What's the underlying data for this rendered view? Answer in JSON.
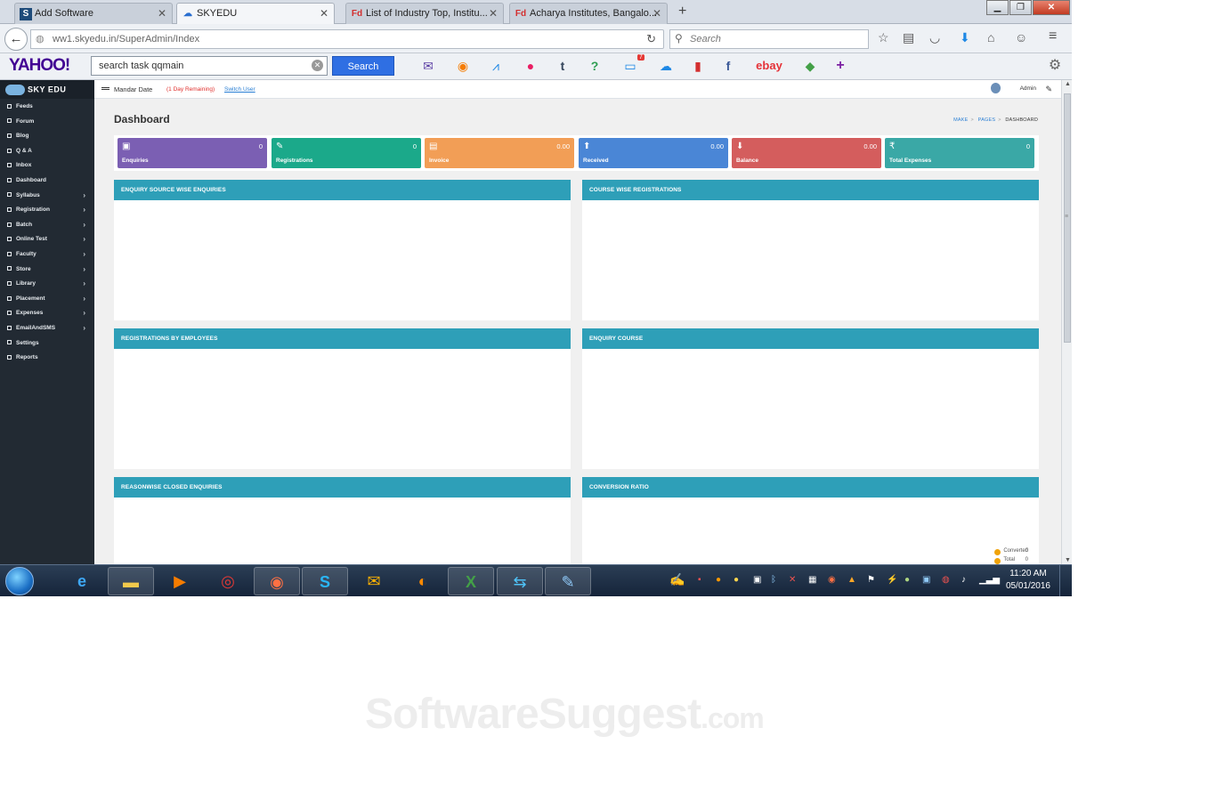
{
  "browser": {
    "tabs": [
      {
        "label": "Add Software",
        "favicon": "S"
      },
      {
        "label": "SKYEDU",
        "favicon": "☁"
      },
      {
        "label": "List of Industry Top, Institu...",
        "favicon": "Fd"
      },
      {
        "label": "Acharya Institutes, Bangalo...",
        "favicon": "Fd"
      }
    ],
    "url": "ww1.skyedu.in/SuperAdmin/Index",
    "search_placeholder": "Search"
  },
  "yahoo": {
    "logo": "YAHOO!",
    "search_value": "search task qqmain",
    "search_button": "Search",
    "news_badge": "7",
    "ebay": "ebay"
  },
  "app": {
    "brand": "SKY EDU",
    "sidebar": [
      {
        "label": "Feeds",
        "has_children": false
      },
      {
        "label": "Forum",
        "has_children": false
      },
      {
        "label": "Blog",
        "has_children": false
      },
      {
        "label": "Q & A",
        "has_children": false
      },
      {
        "label": "Inbox",
        "has_children": false
      },
      {
        "label": "Dashboard",
        "has_children": false
      },
      {
        "label": "Syllabus",
        "has_children": true
      },
      {
        "label": "Registration",
        "has_children": true
      },
      {
        "label": "Batch",
        "has_children": true
      },
      {
        "label": "Online Test",
        "has_children": true
      },
      {
        "label": "Faculty",
        "has_children": true
      },
      {
        "label": "Store",
        "has_children": true
      },
      {
        "label": "Library",
        "has_children": true
      },
      {
        "label": "Placement",
        "has_children": true
      },
      {
        "label": "Expenses",
        "has_children": true
      },
      {
        "label": "EmailAndSMS",
        "has_children": true
      },
      {
        "label": "Settings",
        "has_children": false
      },
      {
        "label": "Reports",
        "has_children": false
      }
    ],
    "topbar": {
      "user_name": "Mandar Date",
      "remaining": "(1 Day Remaining)",
      "switch_user": "Switch User",
      "admin": "Admin"
    },
    "page_title": "Dashboard",
    "breadcrumb": [
      "MAKE",
      "PAGES",
      "DASHBOARD"
    ],
    "stats": [
      {
        "label": "Enquiries",
        "value": "0",
        "color": "#7b5fb3",
        "icon": "user-icon"
      },
      {
        "label": "Registrations",
        "value": "0",
        "color": "#1ba98a",
        "icon": "pencil-icon"
      },
      {
        "label": "Invoice",
        "value": "0.00",
        "color": "#f29e56",
        "icon": "file-icon"
      },
      {
        "label": "Received",
        "value": "0.00",
        "color": "#4a86d6",
        "icon": "arrow-up-icon"
      },
      {
        "label": "Balance",
        "value": "0.00",
        "color": "#d45d5d",
        "icon": "arrow-down-icon"
      },
      {
        "label": "Total Expenses",
        "value": "0",
        "color": "#3aa8a6",
        "icon": "rupee-icon"
      }
    ],
    "panels": [
      {
        "title": "ENQUIRY SOURCE WISE ENQUIRIES"
      },
      {
        "title": "COURSE WISE REGISTRATIONS"
      },
      {
        "title": "REGISTRATIONS BY EMPLOYEES"
      },
      {
        "title": "ENQUIRY COURSE"
      },
      {
        "title": "REASONWISE CLOSED ENQUIRIES"
      },
      {
        "title": "CONVERSION RATIO"
      }
    ],
    "conversion_legend": [
      {
        "label": "Converted",
        "value": "0"
      },
      {
        "label": "Total",
        "value": "0"
      }
    ]
  },
  "taskbar": {
    "time": "11:20 AM",
    "date": "05/01/2016"
  },
  "watermark": {
    "main": "SoftwareSuggest",
    "suffix": ".com"
  }
}
